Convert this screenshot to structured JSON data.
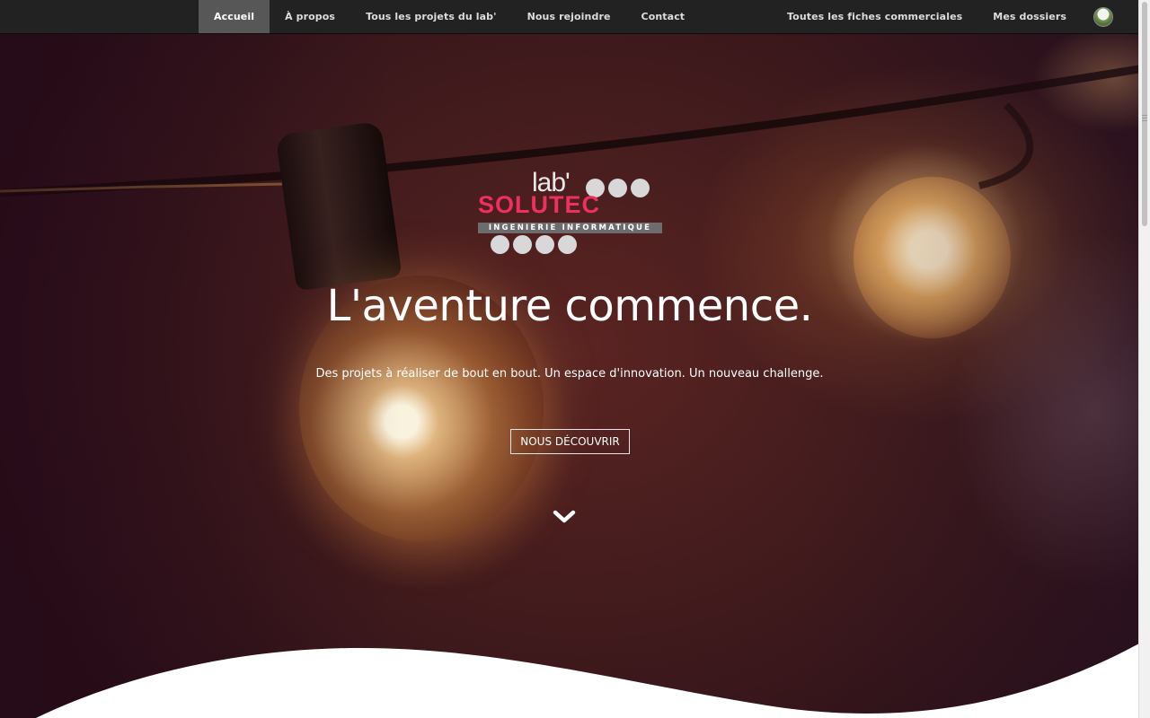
{
  "nav": {
    "left_items": [
      {
        "label": "Accueil",
        "active": true
      },
      {
        "label": "À propos",
        "active": false
      },
      {
        "label": "Tous les projets du lab'",
        "active": false
      },
      {
        "label": "Nous rejoindre",
        "active": false
      },
      {
        "label": "Contact",
        "active": false
      }
    ],
    "right_items": [
      {
        "label": "Toutes les fiches commerciales"
      },
      {
        "label": "Mes dossiers"
      }
    ],
    "avatar_icon": "user-avatar-icon"
  },
  "logo": {
    "lab_text": "lab'",
    "brand_text": "SOLUTEC",
    "tagline": "INGENIERIE INFORMATIQUE",
    "brand_color": "#ee2f5f"
  },
  "hero": {
    "title": "L'aventure commence.",
    "subtitle": "Des projets à réaliser de bout en bout. Un espace d'innovation. Un nouveau challenge.",
    "button_label": "NOUS DÉCOUVRIR",
    "scroll_icon": "chevron-down-icon"
  },
  "colors": {
    "navbar": "#222222",
    "nav_active": "#575757",
    "wave": "#ffffff"
  }
}
